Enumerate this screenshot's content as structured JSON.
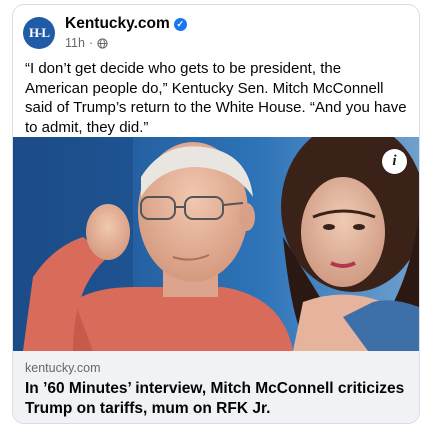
{
  "post": {
    "page_name": "Kentucky.com",
    "avatar_text": "H-L",
    "time": "11h",
    "separator": "·",
    "text": "“I don’t get decide who gets to be president, the American people do,” Kentucky Sen. Mitch McConnell said of Trump’s return to the White House. “And you have to admit, they did.”",
    "verified_icon": "verified-badge-icon",
    "audience_icon": "globe-icon"
  },
  "photo": {
    "info_label": "i"
  },
  "link": {
    "domain": "kentucky.com",
    "headline": "In ’60 Minutes’ interview, Mitch McConnell criticizes Trump on tariffs, mum on RFK Jr."
  },
  "colors": {
    "verified": "#1877f2",
    "avatar_bg": "#1f5ba6",
    "link_bg": "#f0f2f5",
    "muted_text": "#65676b"
  }
}
